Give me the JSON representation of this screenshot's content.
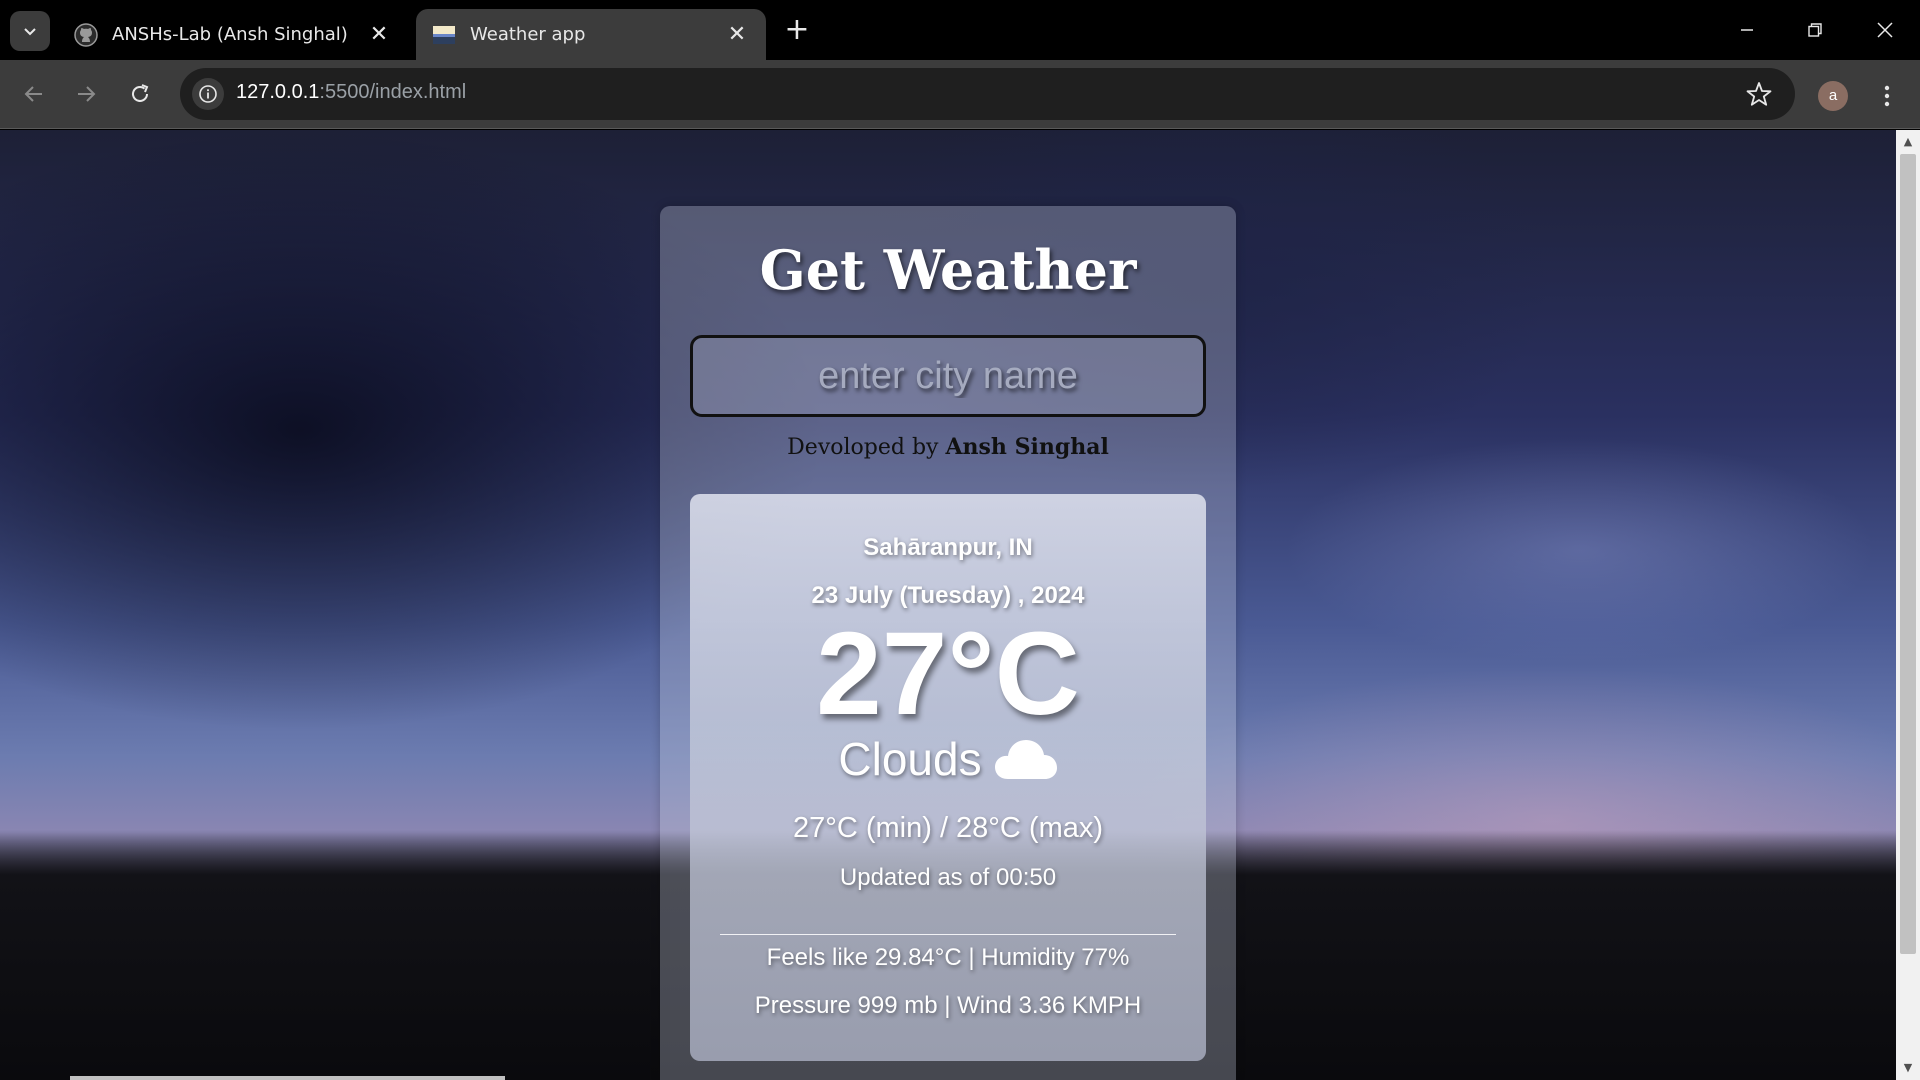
{
  "browser": {
    "tabs": [
      {
        "title": "ANSHs-Lab (Ansh Singhal)",
        "active": false,
        "favicon": "github-icon"
      },
      {
        "title": "Weather app",
        "active": true,
        "favicon": "landscape-image-icon"
      }
    ],
    "url_host": "127.0.0.1",
    "url_rest": ":5500/index.html",
    "profile_initial": "a"
  },
  "app": {
    "title": "Get Weather",
    "search_placeholder": "enter city name",
    "credit_prefix": "Devoloped by",
    "credit_name": "Ansh Singhal"
  },
  "weather": {
    "city": "Sahāranpur, IN",
    "date": "23 July (Tuesday) , 2024",
    "temperature": "27°C",
    "condition": "Clouds",
    "condition_icon": "cloud-icon",
    "min_max": "27°C (min) / 28°C (max)",
    "updated": "Updated as of 00:50",
    "feels_humidity": "Feels like 29.84°C | Humidity 77%",
    "pressure_wind": "Pressure 999 mb | Wind 3.36 KMPH"
  },
  "colors": {
    "chrome_bg": "#000000",
    "toolbar_bg": "#3c3c3c",
    "omnibox_bg": "#1f1f1f"
  }
}
